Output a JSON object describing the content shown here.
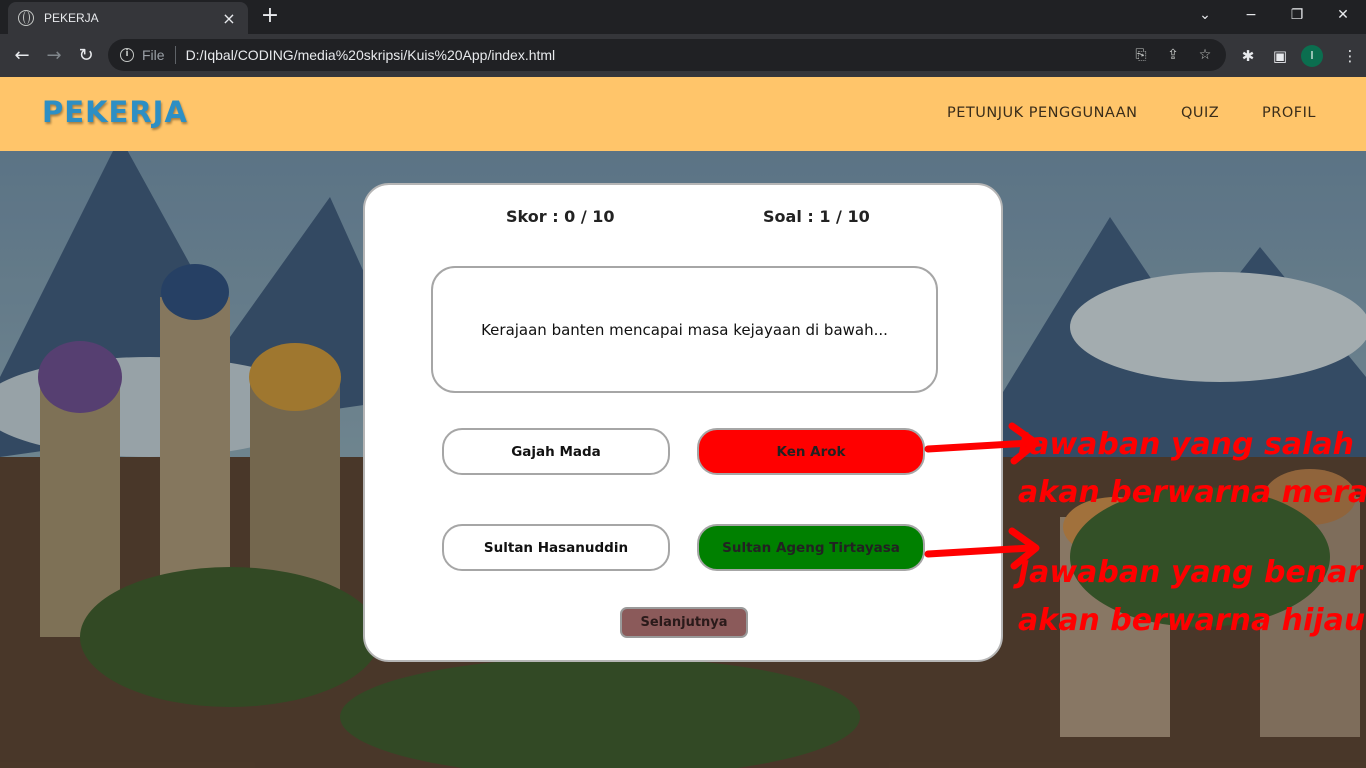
{
  "browser": {
    "tab_title": "PEKERJA",
    "tab_close": "×",
    "new_tab": "+",
    "scheme": "File",
    "url": "D:/Iqbal/CODING/media%20skripsi/Kuis%20App/index.html",
    "profile_initial": "I",
    "icons": {
      "back": "←",
      "forward": "→",
      "reload": "↻",
      "minimize": "−",
      "maximize": "❐",
      "close": "✕",
      "tab_list": "⌄",
      "translate": "⎘",
      "share": "⇪",
      "bookmark": "☆",
      "extensions": "✱",
      "sidepanel": "▣"
    }
  },
  "site": {
    "brand": "PEKERJA",
    "nav": [
      "PETUNJUK PENGGUNAAN",
      "QUIZ",
      "PROFIL"
    ]
  },
  "quiz": {
    "score": "Skor : 0 / 10",
    "question_number": "Soal : 1 / 10",
    "question": "Kerajaan banten mencapai masa kejayaan di bawah...",
    "options": [
      {
        "label": "Gajah Mada",
        "state": "default"
      },
      {
        "label": "Ken Arok",
        "state": "wrong"
      },
      {
        "label": "Sultan Hasanuddin",
        "state": "default"
      },
      {
        "label": "Sultan Ageng Tirtayasa",
        "state": "correct"
      }
    ],
    "next_label": "Selanjutnya"
  },
  "annotations": {
    "wrong_line1": "Jawaban yang salah",
    "wrong_line2": "akan berwarna merah",
    "correct_line1": "Jawaban yang benar",
    "correct_line2": "akan berwarna hijau"
  },
  "colors": {
    "navbar": "#ffc56a",
    "brand": "#2d8fc4",
    "wrong": "#ff0000",
    "correct": "#008000",
    "next_button": "#8b5a5a",
    "annotation": "#ff0000"
  }
}
